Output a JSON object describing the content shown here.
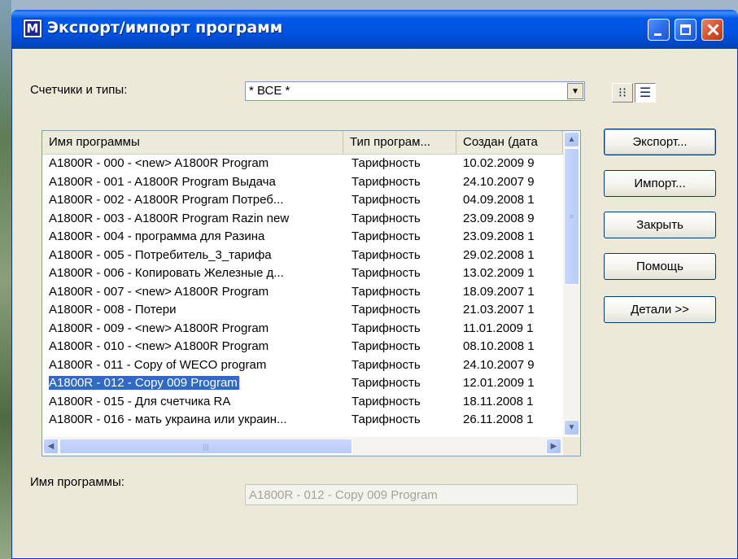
{
  "window": {
    "title": "Экспорт/импорт программ",
    "app_icon_letter": "M"
  },
  "filter": {
    "label": "Счетчики и типы:",
    "selected": "* ВСЕ *"
  },
  "list": {
    "columns": [
      "Имя программы",
      "Тип програм...",
      "Создан (дата"
    ],
    "rows": [
      {
        "name": "A1800R - 000 - <new> A1800R Program",
        "type": "Тарифность",
        "created": "10.02.2009 9"
      },
      {
        "name": "A1800R - 001 -  A1800R Program Выдача",
        "type": "Тарифность",
        "created": "24.10.2007 9"
      },
      {
        "name": "A1800R - 002 -  A1800R Program Потреб...",
        "type": "Тарифность",
        "created": "04.09.2008 1"
      },
      {
        "name": "A1800R - 003 - A1800R Program Razin new",
        "type": "Тарифность",
        "created": "23.09.2008 9"
      },
      {
        "name": "A1800R - 004 - программа для Разина",
        "type": "Тарифность",
        "created": "23.09.2008 1"
      },
      {
        "name": "A1800R - 005 - Потребитель_3_тарифа",
        "type": "Тарифность",
        "created": "29.02.2008 1"
      },
      {
        "name": "A1800R - 006 - Копировать Железные д...",
        "type": "Тарифность",
        "created": "13.02.2009 1"
      },
      {
        "name": "A1800R - 007 - <new> A1800R Program",
        "type": "Тарифность",
        "created": "18.09.2007 1"
      },
      {
        "name": "A1800R - 008 - Потери",
        "type": "Тарифность",
        "created": "21.03.2007 1"
      },
      {
        "name": "A1800R - 009 - <new> A1800R Program",
        "type": "Тарифность",
        "created": "11.01.2009 1"
      },
      {
        "name": "A1800R - 010 - <new> A1800R Program",
        "type": "Тарифность",
        "created": "08.10.2008 1"
      },
      {
        "name": "A1800R - 011 - Copy of WECO program",
        "type": "Тарифность",
        "created": "24.10.2007 9"
      },
      {
        "name": "A1800R - 012 - Copy 009 Program",
        "type": "Тарифность",
        "created": "12.01.2009 1",
        "selected": true
      },
      {
        "name": "A1800R - 015 - Для счетчика RA",
        "type": "Тарифность",
        "created": "18.11.2008 1"
      },
      {
        "name": "A1800R - 016 - мать украина или украин...",
        "type": "Тарифность",
        "created": "26.11.2008 1"
      }
    ]
  },
  "buttons": {
    "export": "Экспорт...",
    "import": "Импорт...",
    "close": "Закрыть",
    "help": "Помощь",
    "details": "Детали >>"
  },
  "program_name": {
    "label": "Имя программы:",
    "value": "A1800R - 012 - Copy 009 Program"
  },
  "icons": {
    "view_list": "list-view-icon",
    "view_details": "details-view-icon",
    "dropdown": "chevron-down-icon"
  }
}
